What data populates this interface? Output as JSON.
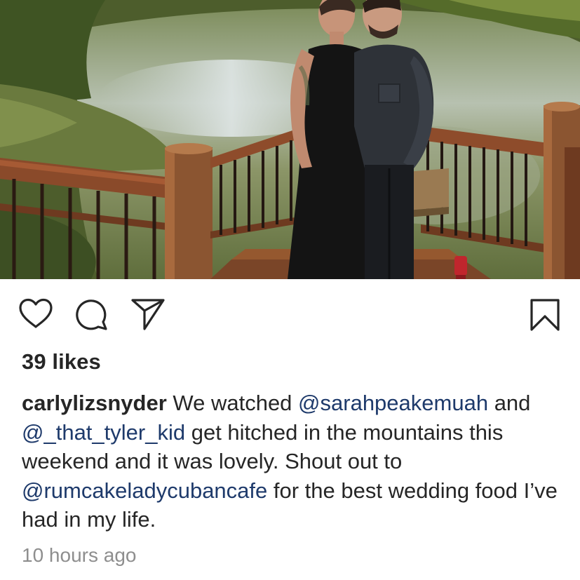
{
  "post": {
    "likes": "39 likes",
    "caption": {
      "username": "carlylizsnyder",
      "segments": [
        {
          "type": "text",
          "text": " We watched "
        },
        {
          "type": "mention",
          "text": "@sarahpeakemuah"
        },
        {
          "type": "text",
          "text": " and "
        },
        {
          "type": "mention",
          "text": "@_that_tyler_kid"
        },
        {
          "type": "text",
          "text": " get hitched in the mountains this weekend and it was lovely. Shout out to "
        },
        {
          "type": "mention",
          "text": "@rumcakeladycubancafe"
        },
        {
          "type": "text",
          "text": " for the best wedding food I’ve had in my life."
        }
      ]
    },
    "timestamp": "10 hours ago"
  },
  "icons": {
    "like": "heart-icon",
    "comment": "comment-bubble-icon",
    "share": "paper-plane-icon",
    "save": "bookmark-icon"
  },
  "colors": {
    "text": "#262626",
    "mention": "#1e3a6b",
    "muted": "#8e8e8e"
  }
}
